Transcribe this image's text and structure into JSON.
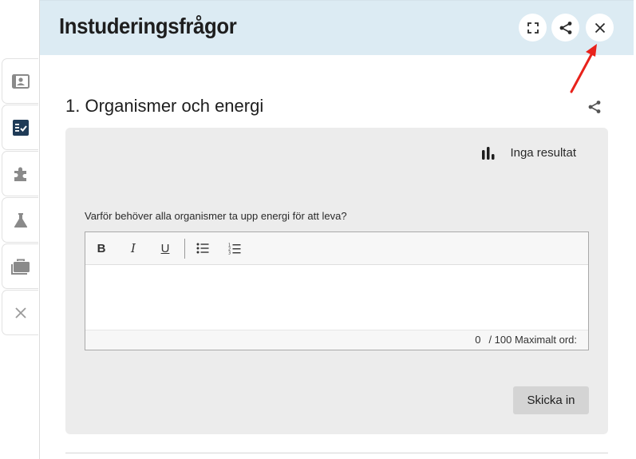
{
  "header": {
    "title": "Instuderingsfrågor",
    "buttons": [
      {
        "name": "expand",
        "icon": "expand-icon"
      },
      {
        "name": "share",
        "icon": "share-icon"
      },
      {
        "name": "close",
        "icon": "close-icon"
      }
    ]
  },
  "rail": {
    "tabs": [
      {
        "icon": "contact-card-icon",
        "active": false
      },
      {
        "icon": "checklist-icon",
        "active": true
      },
      {
        "icon": "puzzle-icon",
        "active": false
      },
      {
        "icon": "flask-icon",
        "active": false
      },
      {
        "icon": "briefcase-icon",
        "active": false
      },
      {
        "icon": "close-icon",
        "active": false
      }
    ]
  },
  "section": {
    "title": "1. Organismer och energi",
    "share_icon": "share-icon"
  },
  "card": {
    "results_label": "Inga resultat",
    "results_icon": "bar-chart-icon",
    "question": "Varför behöver alla organismer ta upp energi för att leva?",
    "editor": {
      "toolbar": {
        "bold": "B",
        "italic": "I",
        "underline": "U",
        "bullet_list_icon": "bullet-list-icon",
        "numbered_list_icon": "numbered-list-icon"
      },
      "value": "",
      "word_count": "0",
      "word_limit_label": "/ 100 Maximalt ord:"
    },
    "submit_label": "Skicka in"
  },
  "colors": {
    "header_bg": "#dcebf3",
    "card_bg": "#ececec",
    "active_tab_icon": "#1f3b57",
    "inactive_tab_icon": "#8a8a8a",
    "annotation_arrow": "#e8221b",
    "submit_bg": "#d4d4d4"
  }
}
